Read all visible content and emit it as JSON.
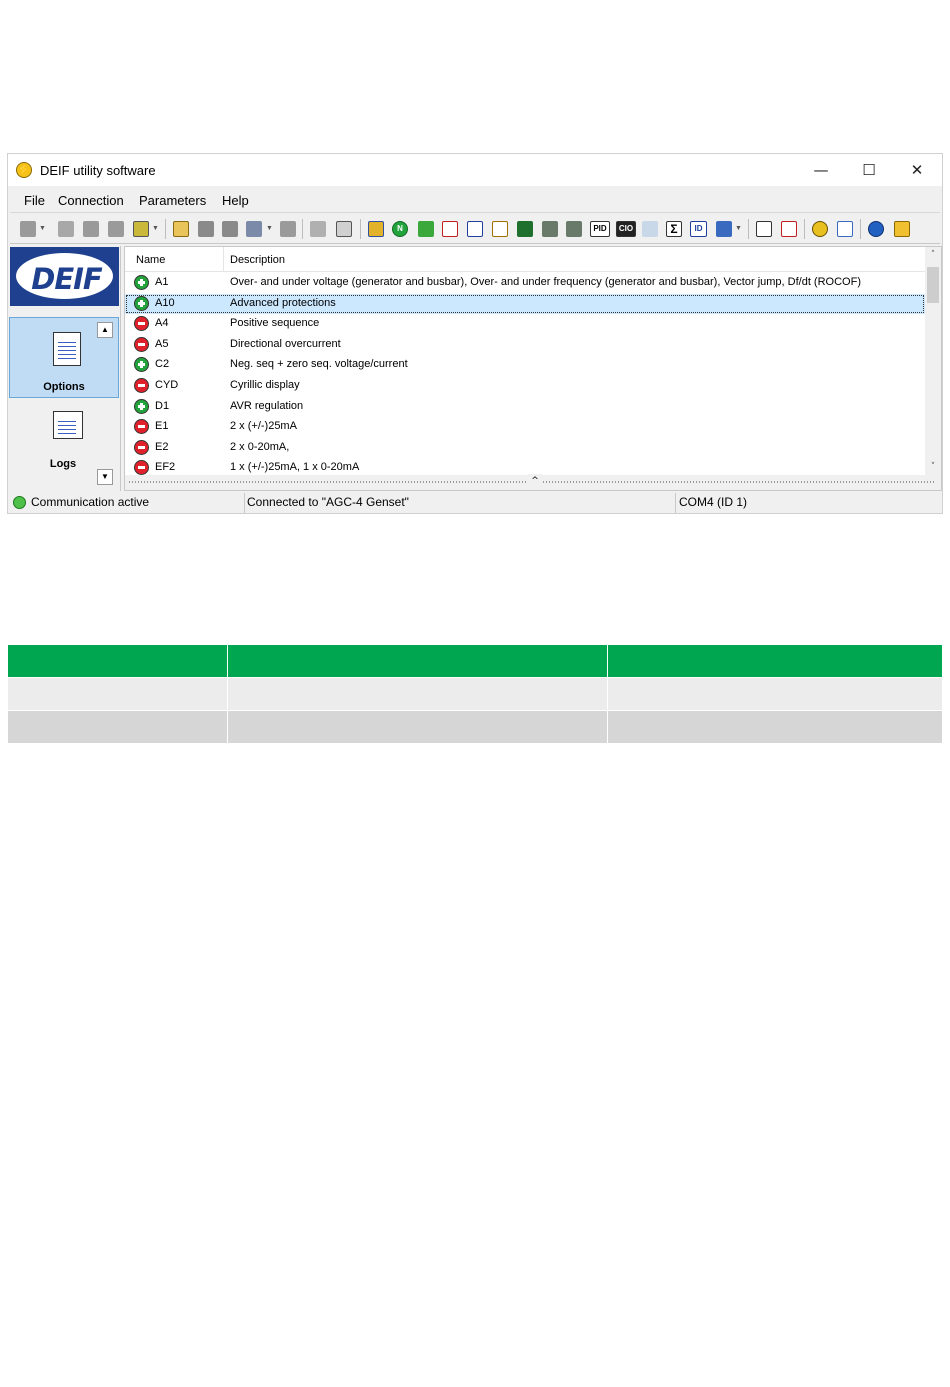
{
  "window": {
    "title": "DEIF utility software",
    "app_icon": "lightning-icon",
    "controls": {
      "minimize": "—",
      "maximize": "☐",
      "close": "✕"
    }
  },
  "menu": [
    "File",
    "Connection",
    "Parameters",
    "Help"
  ],
  "toolbar": {
    "text_buttons": {
      "pid": "PID",
      "cio": "CIO",
      "sigma": "Σ",
      "id": "ID",
      "n": "N"
    }
  },
  "nav": {
    "logo": "DEIF",
    "items": [
      {
        "label": "Options",
        "icon": "options-list-icon",
        "selected": true
      },
      {
        "label": "Logs",
        "icon": "logs-list-icon",
        "selected": false
      }
    ],
    "scroll_up": "▲",
    "scroll_down": "▼"
  },
  "list": {
    "columns": [
      "Name",
      "Description"
    ],
    "rows": [
      {
        "status": "enabled",
        "name": "A1",
        "description": "Over- and under voltage (generator and busbar), Over- and under frequency (generator and busbar), Vector jump, Df/dt (ROCOF)"
      },
      {
        "status": "enabled",
        "name": "A10",
        "description": "Advanced protections",
        "selected": true
      },
      {
        "status": "disabled",
        "name": "A4",
        "description": "Positive sequence"
      },
      {
        "status": "disabled",
        "name": "A5",
        "description": "Directional overcurrent"
      },
      {
        "status": "enabled",
        "name": "C2",
        "description": "Neg. seq + zero seq. voltage/current"
      },
      {
        "status": "disabled",
        "name": "CYD",
        "description": "Cyrillic display"
      },
      {
        "status": "enabled",
        "name": "D1",
        "description": "AVR regulation"
      },
      {
        "status": "disabled",
        "name": "E1",
        "description": "2 x (+/-)25mA"
      },
      {
        "status": "disabled",
        "name": "E2",
        "description": "2 x 0-20mA,"
      },
      {
        "status": "disabled",
        "name": "EF2",
        "description": "1 x (+/-)25mA, 1 x 0-20mA"
      }
    ],
    "scroll_up": "˄",
    "scroll_down": "˅",
    "splitter": "^"
  },
  "statusbar": {
    "communication": "Communication active",
    "connection": "Connected to \"AGC-4 Genset\"",
    "port": "COM4 (ID 1)"
  },
  "table": {
    "header": [
      "",
      "",
      ""
    ],
    "rows": [
      [
        "",
        "",
        ""
      ],
      [
        "",
        "",
        ""
      ]
    ]
  },
  "colors": {
    "accent_green": "#00a650",
    "enabled_icon": "#22a33c",
    "disabled_icon": "#e0202a",
    "selection": "#cce8ff",
    "logo_blue": "#1f3f8f"
  }
}
